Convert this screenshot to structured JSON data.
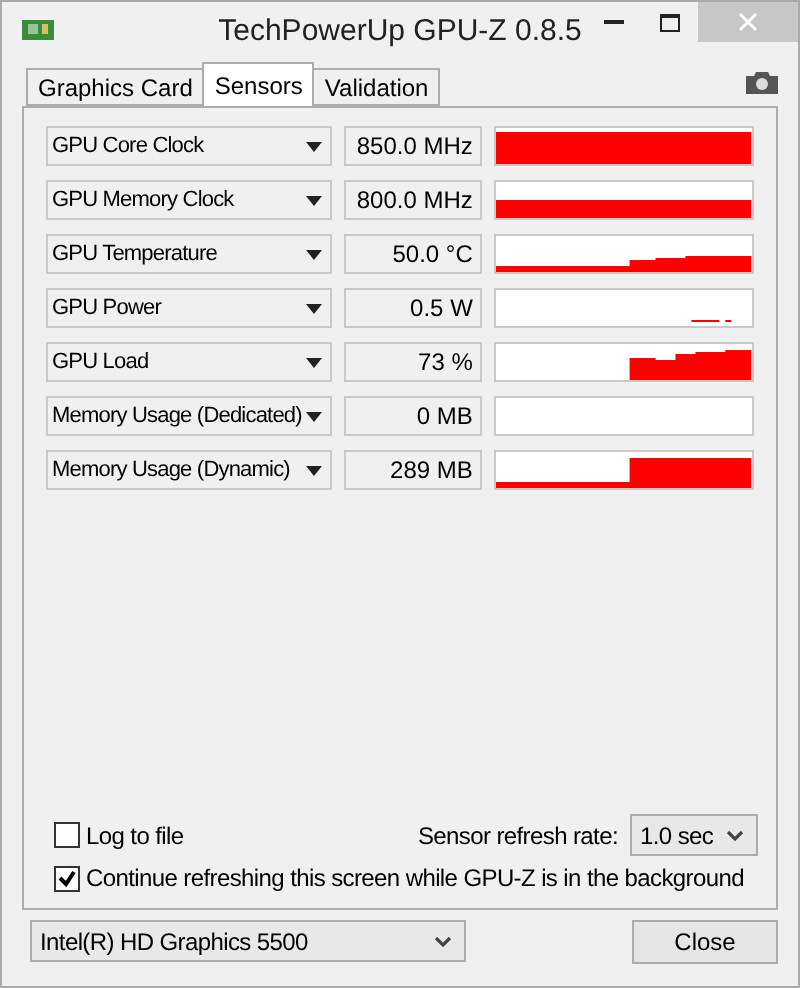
{
  "window": {
    "title": "TechPowerUp GPU-Z 0.8.5"
  },
  "tabs": [
    {
      "label": "Graphics Card",
      "selected": false
    },
    {
      "label": "Sensors",
      "selected": true
    },
    {
      "label": "Validation",
      "selected": false
    }
  ],
  "sensors": [
    {
      "name": "GPU Core Clock",
      "reading": "850.0 MHz"
    },
    {
      "name": "GPU Memory Clock",
      "reading": "800.0 MHz"
    },
    {
      "name": "GPU Temperature",
      "reading": "50.0 °C"
    },
    {
      "name": "GPU Power",
      "reading": "0.5 W"
    },
    {
      "name": "GPU Load",
      "reading": "73 %"
    },
    {
      "name": "Memory Usage (Dedicated)",
      "reading": "0 MB"
    },
    {
      "name": "Memory Usage (Dynamic)",
      "reading": "289 MB"
    }
  ],
  "log_to_file": {
    "label": "Log to file",
    "checked": false
  },
  "refresh_rate": {
    "label": "Sensor refresh rate:",
    "value": "1.0 sec"
  },
  "continue_refreshing": {
    "label": "Continue refreshing this screen while GPU-Z is in the background",
    "checked": true
  },
  "gpu_select": {
    "value": "Intel(R) HD Graphics 5500"
  },
  "close_button": "Close"
}
